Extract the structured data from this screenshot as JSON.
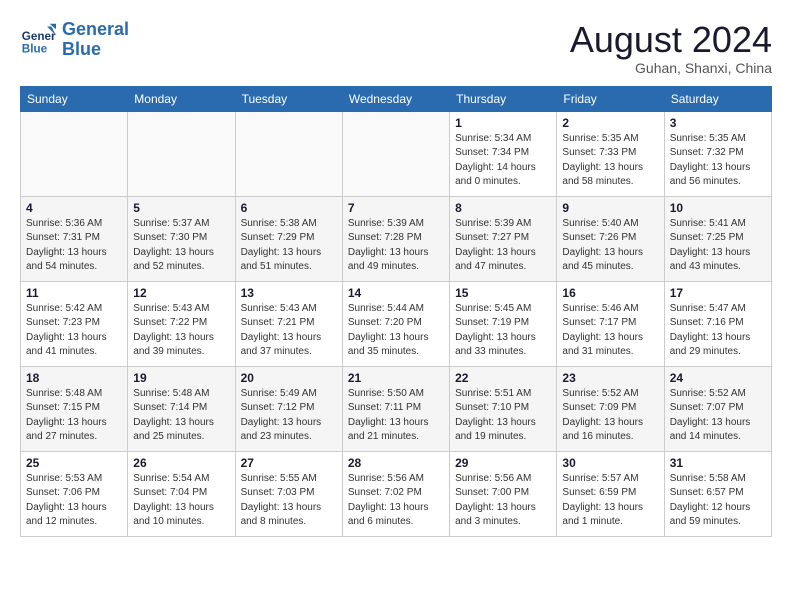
{
  "logo": {
    "line1": "General",
    "line2": "Blue"
  },
  "title": "August 2024",
  "location": "Guhan, Shanxi, China",
  "weekdays": [
    "Sunday",
    "Monday",
    "Tuesday",
    "Wednesday",
    "Thursday",
    "Friday",
    "Saturday"
  ],
  "weeks": [
    {
      "shade": "odd",
      "days": [
        {
          "num": "",
          "info": ""
        },
        {
          "num": "",
          "info": ""
        },
        {
          "num": "",
          "info": ""
        },
        {
          "num": "",
          "info": ""
        },
        {
          "num": "1",
          "info": "Sunrise: 5:34 AM\nSunset: 7:34 PM\nDaylight: 14 hours\nand 0 minutes."
        },
        {
          "num": "2",
          "info": "Sunrise: 5:35 AM\nSunset: 7:33 PM\nDaylight: 13 hours\nand 58 minutes."
        },
        {
          "num": "3",
          "info": "Sunrise: 5:35 AM\nSunset: 7:32 PM\nDaylight: 13 hours\nand 56 minutes."
        }
      ]
    },
    {
      "shade": "even",
      "days": [
        {
          "num": "4",
          "info": "Sunrise: 5:36 AM\nSunset: 7:31 PM\nDaylight: 13 hours\nand 54 minutes."
        },
        {
          "num": "5",
          "info": "Sunrise: 5:37 AM\nSunset: 7:30 PM\nDaylight: 13 hours\nand 52 minutes."
        },
        {
          "num": "6",
          "info": "Sunrise: 5:38 AM\nSunset: 7:29 PM\nDaylight: 13 hours\nand 51 minutes."
        },
        {
          "num": "7",
          "info": "Sunrise: 5:39 AM\nSunset: 7:28 PM\nDaylight: 13 hours\nand 49 minutes."
        },
        {
          "num": "8",
          "info": "Sunrise: 5:39 AM\nSunset: 7:27 PM\nDaylight: 13 hours\nand 47 minutes."
        },
        {
          "num": "9",
          "info": "Sunrise: 5:40 AM\nSunset: 7:26 PM\nDaylight: 13 hours\nand 45 minutes."
        },
        {
          "num": "10",
          "info": "Sunrise: 5:41 AM\nSunset: 7:25 PM\nDaylight: 13 hours\nand 43 minutes."
        }
      ]
    },
    {
      "shade": "odd",
      "days": [
        {
          "num": "11",
          "info": "Sunrise: 5:42 AM\nSunset: 7:23 PM\nDaylight: 13 hours\nand 41 minutes."
        },
        {
          "num": "12",
          "info": "Sunrise: 5:43 AM\nSunset: 7:22 PM\nDaylight: 13 hours\nand 39 minutes."
        },
        {
          "num": "13",
          "info": "Sunrise: 5:43 AM\nSunset: 7:21 PM\nDaylight: 13 hours\nand 37 minutes."
        },
        {
          "num": "14",
          "info": "Sunrise: 5:44 AM\nSunset: 7:20 PM\nDaylight: 13 hours\nand 35 minutes."
        },
        {
          "num": "15",
          "info": "Sunrise: 5:45 AM\nSunset: 7:19 PM\nDaylight: 13 hours\nand 33 minutes."
        },
        {
          "num": "16",
          "info": "Sunrise: 5:46 AM\nSunset: 7:17 PM\nDaylight: 13 hours\nand 31 minutes."
        },
        {
          "num": "17",
          "info": "Sunrise: 5:47 AM\nSunset: 7:16 PM\nDaylight: 13 hours\nand 29 minutes."
        }
      ]
    },
    {
      "shade": "even",
      "days": [
        {
          "num": "18",
          "info": "Sunrise: 5:48 AM\nSunset: 7:15 PM\nDaylight: 13 hours\nand 27 minutes."
        },
        {
          "num": "19",
          "info": "Sunrise: 5:48 AM\nSunset: 7:14 PM\nDaylight: 13 hours\nand 25 minutes."
        },
        {
          "num": "20",
          "info": "Sunrise: 5:49 AM\nSunset: 7:12 PM\nDaylight: 13 hours\nand 23 minutes."
        },
        {
          "num": "21",
          "info": "Sunrise: 5:50 AM\nSunset: 7:11 PM\nDaylight: 13 hours\nand 21 minutes."
        },
        {
          "num": "22",
          "info": "Sunrise: 5:51 AM\nSunset: 7:10 PM\nDaylight: 13 hours\nand 19 minutes."
        },
        {
          "num": "23",
          "info": "Sunrise: 5:52 AM\nSunset: 7:09 PM\nDaylight: 13 hours\nand 16 minutes."
        },
        {
          "num": "24",
          "info": "Sunrise: 5:52 AM\nSunset: 7:07 PM\nDaylight: 13 hours\nand 14 minutes."
        }
      ]
    },
    {
      "shade": "odd",
      "days": [
        {
          "num": "25",
          "info": "Sunrise: 5:53 AM\nSunset: 7:06 PM\nDaylight: 13 hours\nand 12 minutes."
        },
        {
          "num": "26",
          "info": "Sunrise: 5:54 AM\nSunset: 7:04 PM\nDaylight: 13 hours\nand 10 minutes."
        },
        {
          "num": "27",
          "info": "Sunrise: 5:55 AM\nSunset: 7:03 PM\nDaylight: 13 hours\nand 8 minutes."
        },
        {
          "num": "28",
          "info": "Sunrise: 5:56 AM\nSunset: 7:02 PM\nDaylight: 13 hours\nand 6 minutes."
        },
        {
          "num": "29",
          "info": "Sunrise: 5:56 AM\nSunset: 7:00 PM\nDaylight: 13 hours\nand 3 minutes."
        },
        {
          "num": "30",
          "info": "Sunrise: 5:57 AM\nSunset: 6:59 PM\nDaylight: 13 hours\nand 1 minute."
        },
        {
          "num": "31",
          "info": "Sunrise: 5:58 AM\nSunset: 6:57 PM\nDaylight: 12 hours\nand 59 minutes."
        }
      ]
    }
  ]
}
